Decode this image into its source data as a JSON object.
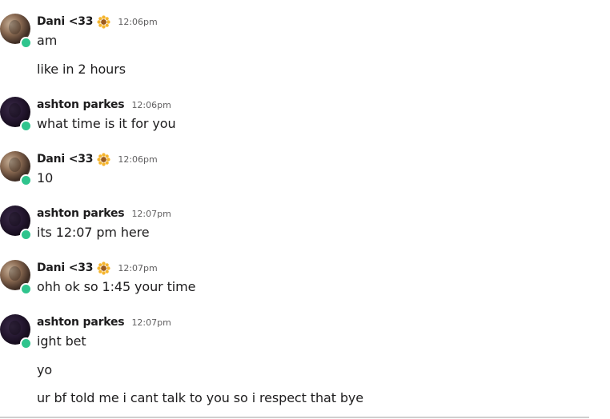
{
  "messages": [
    {
      "author": "Dani <33",
      "emoji": "sunflower-icon",
      "time": "12:06pm",
      "lines": [
        "am",
        "like in 2 hours"
      ]
    },
    {
      "author": "ashton parkes",
      "time": "12:06pm",
      "lines": [
        "what time is it for you"
      ]
    },
    {
      "author": "Dani <33",
      "emoji": "sunflower-icon",
      "time": "12:06pm",
      "lines": [
        "10"
      ]
    },
    {
      "author": "ashton parkes",
      "time": "12:07pm",
      "lines": [
        "its 12:07 pm here"
      ]
    },
    {
      "author": "Dani <33",
      "emoji": "sunflower-icon",
      "time": "12:07pm",
      "lines": [
        "ohh ok so 1:45 your time"
      ]
    },
    {
      "author": "ashton parkes",
      "time": "12:07pm",
      "lines": [
        "ight bet",
        "yo",
        "ur bf told me i cant talk to you so i respect that bye"
      ]
    }
  ],
  "colors": {
    "presence": "#2fc48d",
    "timestamp": "#616061",
    "text": "#1d1c1d"
  }
}
